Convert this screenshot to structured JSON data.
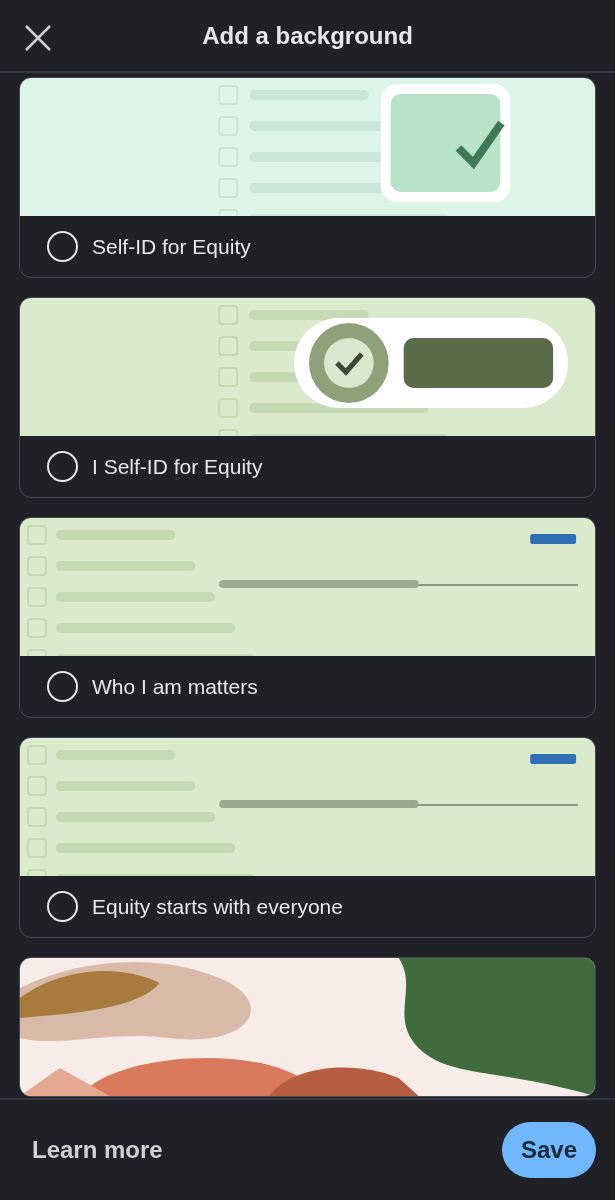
{
  "header": {
    "title": "Add a background"
  },
  "options": [
    {
      "kind": "option",
      "label": "Self-ID for Equity",
      "selected": false
    },
    {
      "kind": "option",
      "label": "I Self-ID for Equity",
      "selected": false
    },
    {
      "kind": "option",
      "label": "Who I am matters",
      "selected": false
    },
    {
      "kind": "option",
      "label": "Equity starts with everyone",
      "selected": false
    },
    {
      "kind": "picture"
    }
  ],
  "footer": {
    "link": "Learn more",
    "button": "Save"
  }
}
